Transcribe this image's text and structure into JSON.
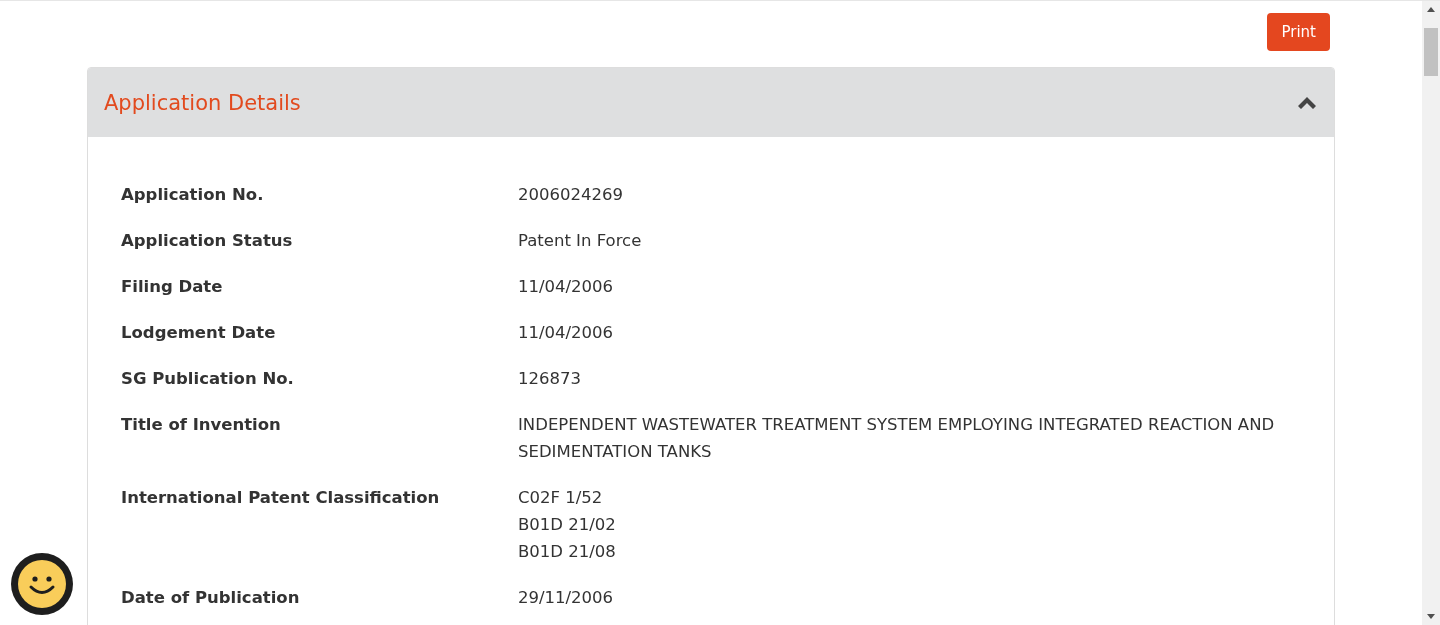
{
  "print_button": {
    "label": "Print"
  },
  "panel": {
    "title": "Application Details",
    "expanded": true,
    "rows": [
      {
        "label": "Application No.",
        "values": [
          "2006024269"
        ]
      },
      {
        "label": "Application Status",
        "values": [
          "Patent In Force"
        ]
      },
      {
        "label": "Filing Date",
        "values": [
          "11/04/2006"
        ]
      },
      {
        "label": "Lodgement Date",
        "values": [
          "11/04/2006"
        ]
      },
      {
        "label": "SG Publication No.",
        "values": [
          "126873"
        ]
      },
      {
        "label": "Title of Invention",
        "values": [
          "INDEPENDENT WASTEWATER TREATMENT SYSTEM EMPLOYING INTEGRATED REACTION AND SEDIMENTATION TANKS"
        ]
      },
      {
        "label": "International Patent Classification",
        "values": [
          "C02F 1/52",
          "B01D 21/02",
          "B01D 21/08"
        ]
      },
      {
        "label": "Date of Publication",
        "values": [
          "29/11/2006"
        ]
      }
    ]
  }
}
